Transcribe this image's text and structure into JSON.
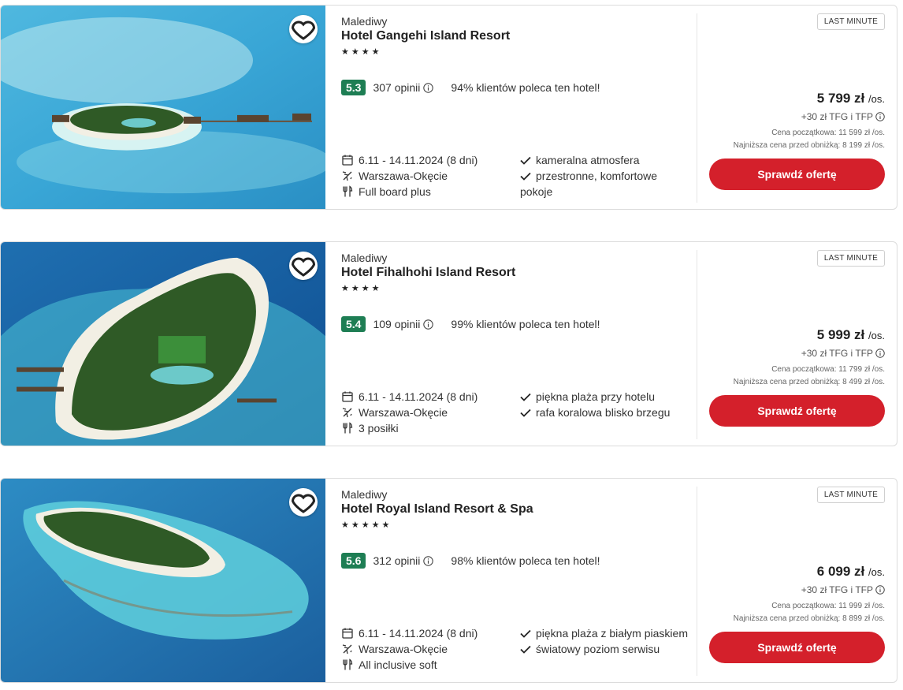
{
  "offers": [
    {
      "location": "Malediwy",
      "name": "Hotel Gangehi Island Resort",
      "stars": "★★★★",
      "score": "5.3",
      "reviews": "307 opinii",
      "recommend": "94% klientów poleca ten hotel!",
      "dates": "6.11 - 14.11.2024 (8 dni)",
      "departure": "Warszawa-Okęcie",
      "board": "Full board plus",
      "features": [
        "kameralna atmosfera",
        "przestronne, komfortowe pokoje"
      ],
      "badge": "LAST MINUTE",
      "price": "5 799 zł",
      "per_person": "/os.",
      "fees": "+30 zł TFG i TFP",
      "start_price": "Cena początkowa: 11 599 zł /os.",
      "lowest_price": "Najniższa cena przed obniżką: 8 199 zł /os.",
      "cta": "Sprawdź ofertę"
    },
    {
      "location": "Malediwy",
      "name": "Hotel Fihalhohi Island Resort",
      "stars": "★★★★",
      "score": "5.4",
      "reviews": "109 opinii",
      "recommend": "99% klientów poleca ten hotel!",
      "dates": "6.11 - 14.11.2024 (8 dni)",
      "departure": "Warszawa-Okęcie",
      "board": "3 posiłki",
      "features": [
        "piękna plaża przy hotelu",
        "rafa koralowa blisko brzegu"
      ],
      "badge": "LAST MINUTE",
      "price": "5 999 zł",
      "per_person": "/os.",
      "fees": "+30 zł TFG i TFP",
      "start_price": "Cena początkowa: 11 799 zł /os.",
      "lowest_price": "Najniższa cena przed obniżką: 8 499 zł /os.",
      "cta": "Sprawdź ofertę"
    },
    {
      "location": "Malediwy",
      "name": "Hotel Royal Island Resort & Spa",
      "stars": "★★★★★",
      "score": "5.6",
      "reviews": "312 opinii",
      "recommend": "98% klientów poleca ten hotel!",
      "dates": "6.11 - 14.11.2024 (8 dni)",
      "departure": "Warszawa-Okęcie",
      "board": "All inclusive soft",
      "features": [
        "piękna plaża z białym piaskiem",
        "światowy poziom serwisu"
      ],
      "badge": "LAST MINUTE",
      "price": "6 099 zł",
      "per_person": "/os.",
      "fees": "+30 zł TFG i TFP",
      "start_price": "Cena początkowa: 11 999 zł /os.",
      "lowest_price": "Najniższa cena przed obniżką: 8 899 zł /os.",
      "cta": "Sprawdź ofertę"
    }
  ],
  "colors": {
    "cta": "#d4202b",
    "score": "#1e7e54",
    "ocean": "#2a8fc4",
    "lagoon": "#5fd0dd",
    "vegetation": "#2f5a26",
    "sand": "#f2efe4"
  },
  "icons": {
    "favorite": "heart-icon",
    "info": "info-icon",
    "dates": "calendar-icon",
    "departure": "plane-icon",
    "board": "cutlery-icon",
    "feature": "check-icon"
  }
}
